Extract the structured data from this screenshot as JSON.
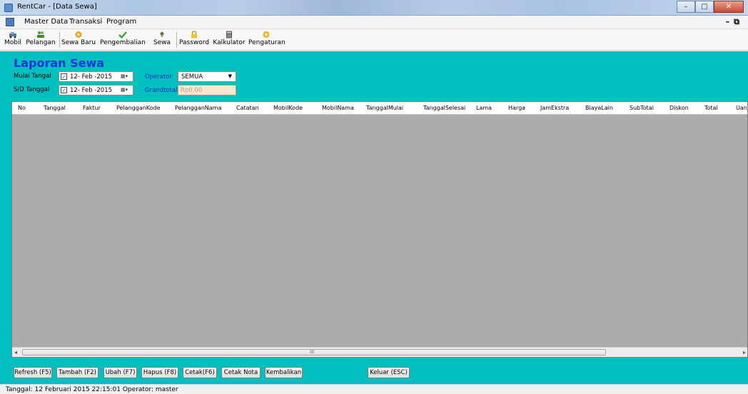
{
  "window": {
    "title": "RentCar - [Data Sewa]"
  },
  "menu": {
    "items": [
      "Master Data",
      "Transaksi",
      "Program"
    ]
  },
  "toolbar": {
    "items": [
      {
        "label": "Mobil",
        "icon": "car-icon"
      },
      {
        "label": "Pelangan",
        "icon": "users-icon"
      },
      {
        "label": "Sewa Baru",
        "icon": "new-rent-icon"
      },
      {
        "label": "Pengembalian",
        "icon": "check-icon"
      },
      {
        "label": "Sewa",
        "icon": "rent-icon"
      },
      {
        "label": "Password",
        "icon": "lock-icon"
      },
      {
        "label": "Kalkulator",
        "icon": "calculator-icon"
      },
      {
        "label": "Pengaturan",
        "icon": "gear-icon"
      }
    ]
  },
  "form": {
    "title": "Laporan Sewa",
    "mulai_label": "Mulai Tangal",
    "sd_label": "S/D Tanggal",
    "mulai_date": "12- Feb -2015",
    "sd_date": "12- Feb -2015",
    "operator_label": "Operator",
    "operator_value": "SEMUA",
    "grandtotal_label": "Grandtotal",
    "grandtotal_value": "Rp0,00"
  },
  "grid": {
    "columns": [
      "No",
      "Tanggal",
      "Faktur",
      "PelangganKode",
      "PelangganNama",
      "Catatan",
      "MobilKode",
      "MobilNama",
      "TanggalMulai",
      "TanggalSelesai",
      "Lama",
      "Harga",
      "JamEkstra",
      "BiayaLain",
      "SubTotal",
      "Diskon",
      "Total",
      "Uan"
    ]
  },
  "buttons": [
    "Refresh (F5)",
    "Tambah (F2)",
    "Ubah (F7)",
    "Hapus (F8)",
    "Cetak(F6)",
    "Cetak Nota",
    "Kembalikan",
    "Keluar (ESC)"
  ],
  "status": {
    "text": "Tanggal: 12 Februari 2015 22:15:01  Operator: master"
  },
  "colors": {
    "main_bg": "#00bfbf",
    "title_color": "#1833d8",
    "grid_bg": "#ababab",
    "grandtotal_bg": "#fde7cf"
  }
}
